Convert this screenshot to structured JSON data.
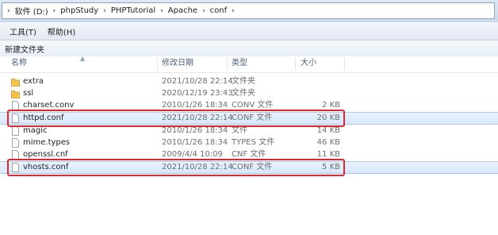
{
  "breadcrumb": {
    "segments": [
      "软件 (D:)",
      "phpStudy",
      "PHPTutorial",
      "Apache",
      "conf"
    ]
  },
  "menu": {
    "tools": "工具(T)",
    "help": "帮助(H)"
  },
  "toolbar": {
    "new_folder": "新建文件夹"
  },
  "columns": {
    "name": "名称",
    "date": "修改日期",
    "type": "类型",
    "size": "大小"
  },
  "files": [
    {
      "name": "extra",
      "date": "2021/10/28 22:14",
      "type": "文件夹",
      "size": "",
      "icon": "folder-icon"
    },
    {
      "name": "ssl",
      "date": "2020/12/19 23:43",
      "type": "文件夹",
      "size": "",
      "icon": "folder-icon"
    },
    {
      "name": "charset.conv",
      "date": "2010/1/26 18:34",
      "type": "CONV 文件",
      "size": "2 KB",
      "icon": "file-icon"
    },
    {
      "name": "httpd.conf",
      "date": "2021/10/28 22:14",
      "type": "CONF 文件",
      "size": "20 KB",
      "icon": "file-icon"
    },
    {
      "name": "magic",
      "date": "2010/1/26 18:34",
      "type": "文件",
      "size": "14 KB",
      "icon": "file-icon"
    },
    {
      "name": "mime.types",
      "date": "2010/1/26 18:34",
      "type": "TYPES 文件",
      "size": "46 KB",
      "icon": "file-icon"
    },
    {
      "name": "openssl.cnf",
      "date": "2009/4/4 10:09",
      "type": "CNF 文件",
      "size": "11 KB",
      "icon": "file-icon"
    },
    {
      "name": "vhosts.conf",
      "date": "2021/10/28 22:14",
      "type": "CONF 文件",
      "size": "5 KB",
      "icon": "file-icon"
    }
  ],
  "colors": {
    "highlight_border": "#e0262e",
    "selection": "#d6e7fb",
    "folder": "#f2c14e"
  }
}
